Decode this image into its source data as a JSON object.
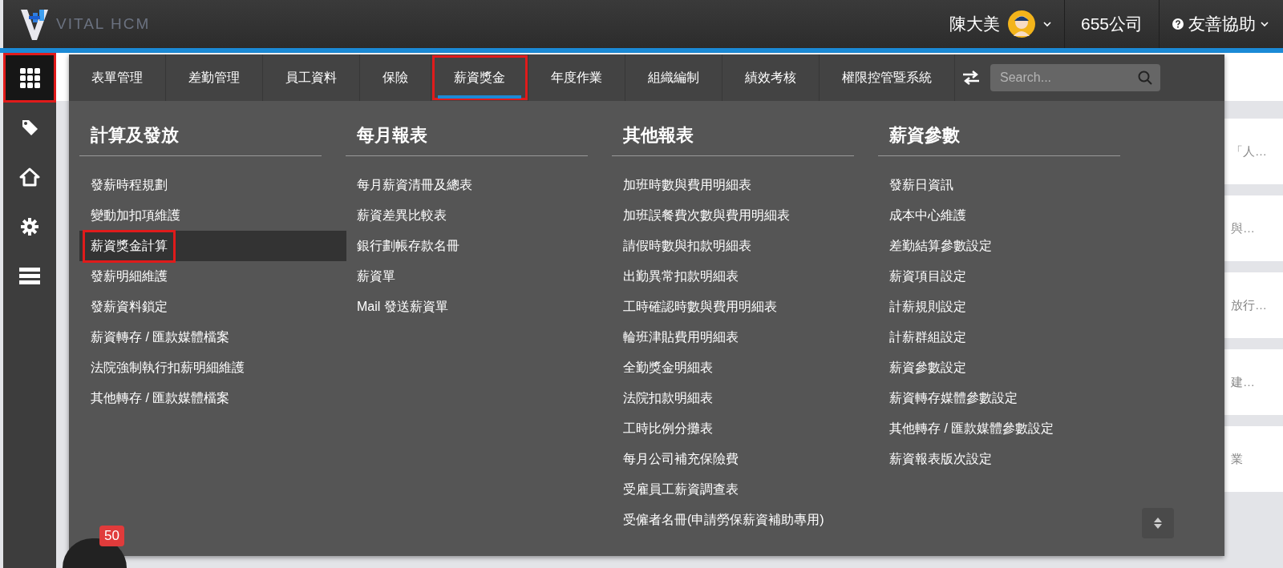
{
  "header": {
    "logo_text": "VITAL HCM",
    "user_name": "陳大美",
    "company": "655公司",
    "help": "友善協助"
  },
  "sidebar": {
    "items": [
      {
        "kind": "apps",
        "selected": true,
        "highlighted": true
      },
      {
        "kind": "tag",
        "selected": false,
        "highlighted": false
      },
      {
        "kind": "home",
        "selected": false,
        "highlighted": false
      },
      {
        "kind": "settings",
        "selected": false,
        "highlighted": false
      },
      {
        "kind": "list",
        "selected": false,
        "highlighted": false
      }
    ]
  },
  "menu": {
    "tabs": [
      {
        "label": "表單管理",
        "selected": false,
        "highlighted": false
      },
      {
        "label": "差勤管理",
        "selected": false,
        "highlighted": false
      },
      {
        "label": "員工資料",
        "selected": false,
        "highlighted": false
      },
      {
        "label": "保險",
        "selected": false,
        "highlighted": false
      },
      {
        "label": "薪資獎金",
        "selected": true,
        "highlighted": true
      },
      {
        "label": "年度作業",
        "selected": false,
        "highlighted": false
      },
      {
        "label": "組織編制",
        "selected": false,
        "highlighted": false
      },
      {
        "label": "績效考核",
        "selected": false,
        "highlighted": false
      },
      {
        "label": "權限控管暨系統",
        "selected": false,
        "highlighted": false
      }
    ],
    "search": {
      "placeholder": "Search..."
    },
    "columns": [
      {
        "heading": "計算及發放",
        "items": [
          {
            "label": "發薪時程規劃",
            "selected": false,
            "highlighted": false
          },
          {
            "label": "變動加扣項維護",
            "selected": false,
            "highlighted": false
          },
          {
            "label": "薪資獎金計算",
            "selected": true,
            "highlighted": true
          },
          {
            "label": "發薪明細維護",
            "selected": false,
            "highlighted": false
          },
          {
            "label": "發薪資料鎖定",
            "selected": false,
            "highlighted": false
          },
          {
            "label": "薪資轉存 / 匯款媒體檔案",
            "selected": false,
            "highlighted": false
          },
          {
            "label": "法院強制執行扣薪明細維護",
            "selected": false,
            "highlighted": false
          },
          {
            "label": "其他轉存 / 匯款媒體檔案",
            "selected": false,
            "highlighted": false
          }
        ]
      },
      {
        "heading": "每月報表",
        "items": [
          {
            "label": "每月薪資清冊及總表",
            "selected": false,
            "highlighted": false
          },
          {
            "label": "薪資差異比較表",
            "selected": false,
            "highlighted": false
          },
          {
            "label": "銀行劃帳存款名冊",
            "selected": false,
            "highlighted": false
          },
          {
            "label": "薪資單",
            "selected": false,
            "highlighted": false
          },
          {
            "label": "Mail 發送薪資單",
            "selected": false,
            "highlighted": false
          }
        ]
      },
      {
        "heading": "其他報表",
        "items": [
          {
            "label": "加班時數與費用明細表",
            "selected": false,
            "highlighted": false
          },
          {
            "label": "加班誤餐費次數與費用明細表",
            "selected": false,
            "highlighted": false
          },
          {
            "label": "請假時數與扣款明細表",
            "selected": false,
            "highlighted": false
          },
          {
            "label": "出勤異常扣款明細表",
            "selected": false,
            "highlighted": false
          },
          {
            "label": "工時確認時數與費用明細表",
            "selected": false,
            "highlighted": false
          },
          {
            "label": "輪班津貼費用明細表",
            "selected": false,
            "highlighted": false
          },
          {
            "label": "全勤獎金明細表",
            "selected": false,
            "highlighted": false
          },
          {
            "label": "法院扣款明細表",
            "selected": false,
            "highlighted": false
          },
          {
            "label": "工時比例分攤表",
            "selected": false,
            "highlighted": false
          },
          {
            "label": "每月公司補充保險費",
            "selected": false,
            "highlighted": false
          },
          {
            "label": "受雇員工薪資調查表",
            "selected": false,
            "highlighted": false
          },
          {
            "label": "受僱者名冊(申請勞保薪資補助專用)",
            "selected": false,
            "highlighted": false
          }
        ]
      },
      {
        "heading": "薪資參數",
        "items": [
          {
            "label": "發薪日資訊",
            "selected": false,
            "highlighted": false
          },
          {
            "label": "成本中心維護",
            "selected": false,
            "highlighted": false
          },
          {
            "label": "差勤結算參數設定",
            "selected": false,
            "highlighted": false
          },
          {
            "label": "薪資項目設定",
            "selected": false,
            "highlighted": false
          },
          {
            "label": "計薪規則設定",
            "selected": false,
            "highlighted": false
          },
          {
            "label": "計薪群組設定",
            "selected": false,
            "highlighted": false
          },
          {
            "label": "薪資參數設定",
            "selected": false,
            "highlighted": false
          },
          {
            "label": "薪資轉存媒體參數設定",
            "selected": false,
            "highlighted": false
          },
          {
            "label": "其他轉存 / 匯款媒體參數設定",
            "selected": false,
            "highlighted": false
          },
          {
            "label": "薪資報表版次設定",
            "selected": false,
            "highlighted": false
          }
        ]
      }
    ]
  },
  "background_cards": [
    "「人…",
    "與…",
    "放行…",
    "建…",
    "業"
  ],
  "notification": {
    "count": "50"
  }
}
